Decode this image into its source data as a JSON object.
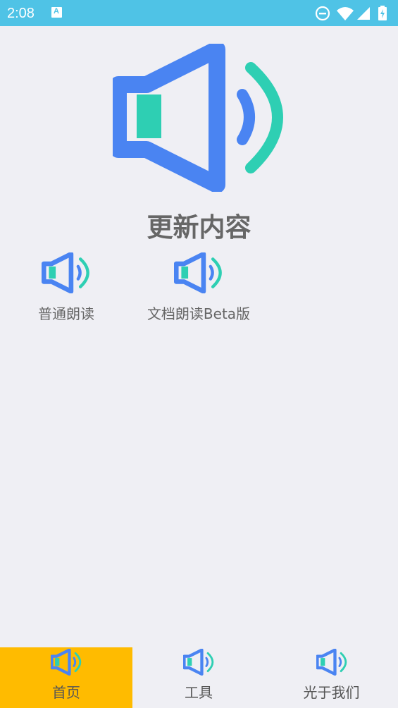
{
  "status_bar": {
    "time": "2:08",
    "notification_letter": "A"
  },
  "hero": {
    "icon": "speaker-icon",
    "title": "更新内容"
  },
  "features": [
    {
      "label": "普通朗读",
      "icon": "speaker-icon"
    },
    {
      "label": "文档朗读Beta版",
      "icon": "speaker-icon"
    }
  ],
  "tabs": [
    {
      "label": "首页",
      "icon": "speaker-icon",
      "active": true
    },
    {
      "label": "工具",
      "icon": "speaker-icon",
      "active": false
    },
    {
      "label": "光于我们",
      "icon": "speaker-icon",
      "active": false
    }
  ],
  "colors": {
    "status_bar": "#4fc3e6",
    "speaker_blue": "#4a84f2",
    "speaker_green": "#2ecfb3",
    "active_tab": "#ffbb00",
    "background": "#efeff4"
  }
}
